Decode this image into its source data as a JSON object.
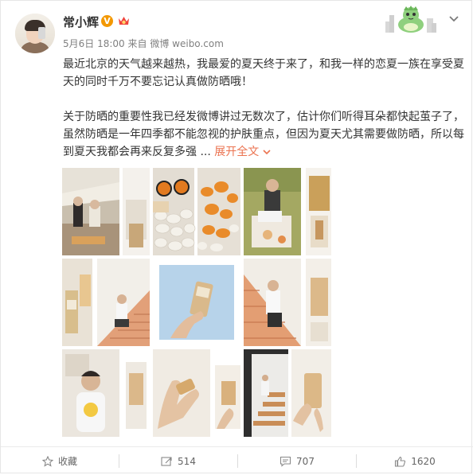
{
  "user": {
    "name": "常小辉",
    "verified_badge": "V",
    "avatar_icon": "user-avatar"
  },
  "meta": {
    "date": "5月6日 18:00",
    "source_prefix": "来自",
    "source": "微博 weibo.com"
  },
  "post": {
    "paragraph1": "最近北京的天气越来越热，我最爱的夏天终于来了，和我一样的恋夏一族在享受夏天的同时千万不要忘记认真做防晒哦！",
    "paragraph2": "关于防晒的重要性我已经发微博讲过无数次了，估计你们听得耳朵都快起茧子了，虽然防晒是一年四季都不能忽视的护肤重点，但因为夏天尤其需要做防晒，所以每到夏天我都会再来反复多强 ...",
    "expand_label": "展开全文",
    "expand_icon": "chevron-down-icon"
  },
  "photos": [
    {
      "label": "outdoor-picnic-collage"
    },
    {
      "label": "sunglasses-stones-orange"
    },
    {
      "label": "picnic-lawn-collage"
    },
    {
      "label": "sunscreen-stairs-collage"
    },
    {
      "label": "hand-holding-sunscreen"
    },
    {
      "label": "orange-stairs-collage"
    },
    {
      "label": "smiley-tshirt-collage"
    },
    {
      "label": "hands-product-collage"
    },
    {
      "label": "staircase-collage"
    }
  ],
  "actions": {
    "favorite_label": "收藏",
    "repost_count": "514",
    "comment_count": "707",
    "like_count": "1620"
  },
  "colors": {
    "accent": "#eb7350",
    "verified": "#f39800",
    "text": "#333333",
    "muted": "#808080"
  }
}
